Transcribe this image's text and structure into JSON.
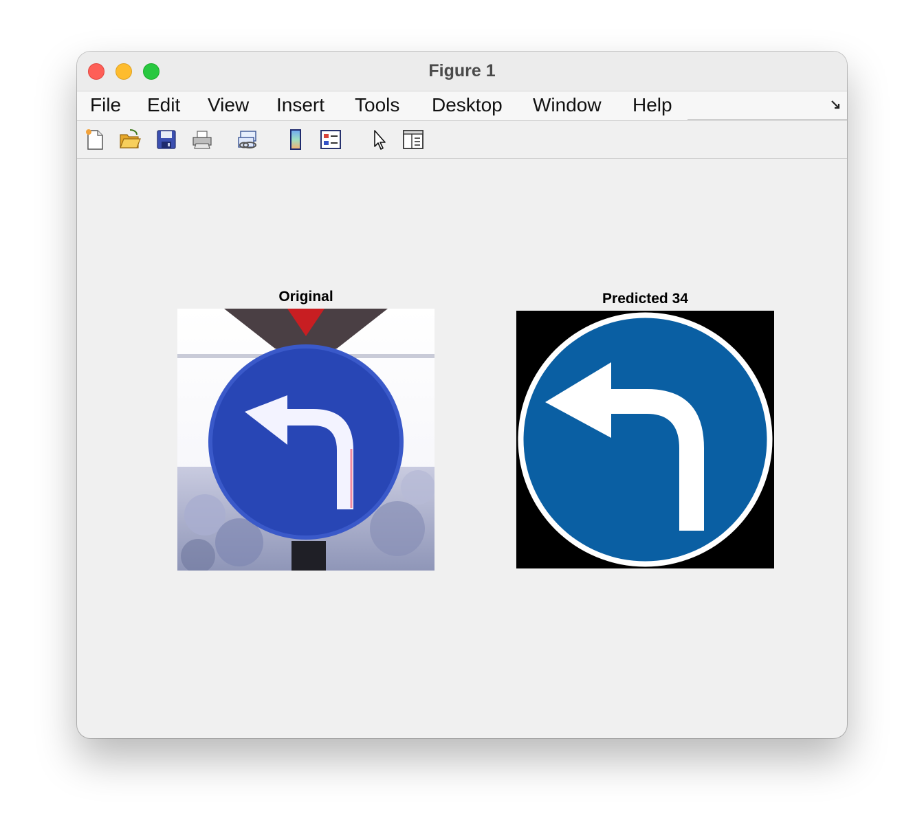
{
  "window": {
    "title": "Figure 1"
  },
  "menu": [
    "File",
    "Edit",
    "View",
    "Insert",
    "Tools",
    "Desktop",
    "Window",
    "Help"
  ],
  "toolbar": {
    "icons": [
      "new-figure-icon",
      "open-file-icon",
      "save-icon",
      "print-icon",
      "link-plot-icon",
      "colorbar-icon",
      "legend-icon",
      "pointer-icon",
      "property-inspector-icon"
    ]
  },
  "axes": [
    {
      "title": "Original"
    },
    {
      "title": "Predicted 34"
    }
  ],
  "colors": {
    "sign_blue_original": "#2a4ab8",
    "sign_blue_predicted": "#0a5fa3"
  }
}
